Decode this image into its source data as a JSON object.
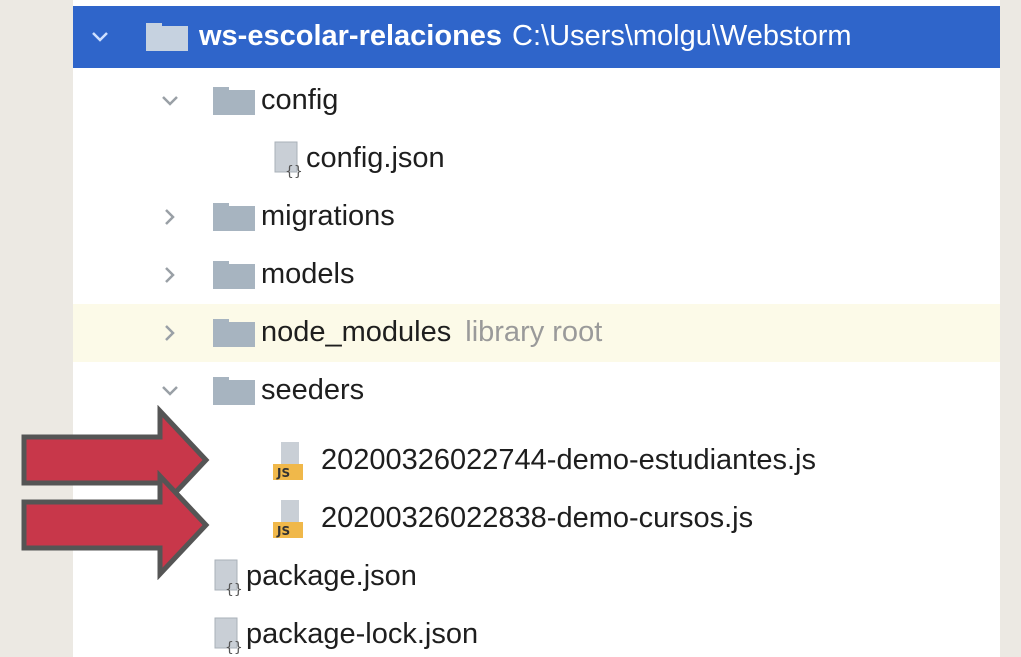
{
  "tree": {
    "root": {
      "name": "ws-escolar-relaciones",
      "path": "C:\\Users\\molgu\\Webstorm"
    },
    "items": [
      {
        "label": "config",
        "type": "folder",
        "expanded": true
      },
      {
        "label": "config.json",
        "type": "json-file"
      },
      {
        "label": "migrations",
        "type": "folder",
        "expanded": false
      },
      {
        "label": "models",
        "type": "folder",
        "expanded": false
      },
      {
        "label": "node_modules",
        "hint": "library root",
        "type": "folder",
        "expanded": false
      },
      {
        "label": "seeders",
        "type": "folder",
        "expanded": true
      },
      {
        "label": "20200326022744-demo-estudiantes.js",
        "type": "js-file"
      },
      {
        "label": "20200326022838-demo-cursos.js",
        "type": "js-file"
      },
      {
        "label": "package.json",
        "type": "json-file"
      },
      {
        "label": "package-lock.json",
        "type": "json-file"
      }
    ]
  },
  "icons": {
    "chevron_expanded": "chevron-down-icon",
    "chevron_collapsed": "chevron-right-icon",
    "folder": "folder-icon",
    "json": "json-file-icon",
    "js": "js-file-icon",
    "annotation_arrow": "red-arrow-icon"
  },
  "colors": {
    "selection": "#2f65ca",
    "highlight_row": "#fcfae8",
    "folder": "#a7b4c0",
    "arrow_fill": "#c8374a",
    "arrow_stroke": "#555555",
    "js_badge": "#f0b84a",
    "background": "#ece9e3"
  }
}
